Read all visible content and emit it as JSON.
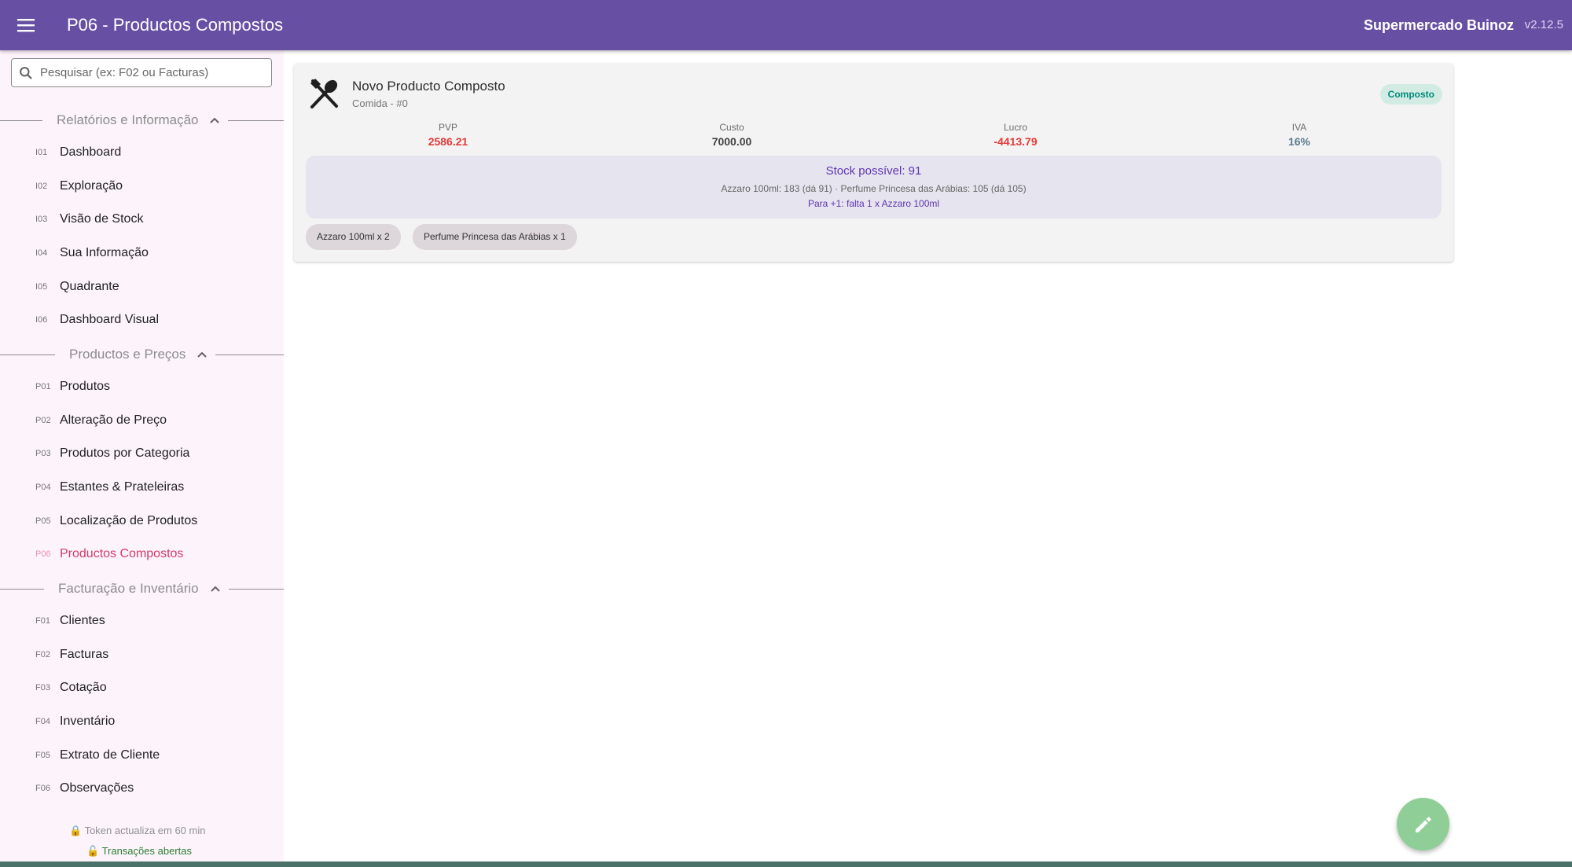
{
  "header": {
    "title": "P06 - Productos Compostos",
    "brand": "Supermercado Buinoz",
    "version": "v2.12.5"
  },
  "search": {
    "placeholder": "Pesquisar (ex: F02 ou Facturas)"
  },
  "sidebar": {
    "sections": [
      {
        "label": "Relatórios e Informação",
        "items": [
          {
            "code": "I01",
            "label": "Dashboard"
          },
          {
            "code": "I02",
            "label": "Exploração"
          },
          {
            "code": "I03",
            "label": "Visão de Stock"
          },
          {
            "code": "I04",
            "label": "Sua Informação"
          },
          {
            "code": "I05",
            "label": "Quadrante"
          },
          {
            "code": "I06",
            "label": "Dashboard Visual"
          }
        ]
      },
      {
        "label": "Productos e Preços",
        "items": [
          {
            "code": "P01",
            "label": "Produtos"
          },
          {
            "code": "P02",
            "label": "Alteração de Preço"
          },
          {
            "code": "P03",
            "label": "Produtos por Categoria"
          },
          {
            "code": "P04",
            "label": "Estantes & Prateleiras"
          },
          {
            "code": "P05",
            "label": "Localização de Produtos"
          },
          {
            "code": "P06",
            "label": "Productos Compostos",
            "active": true
          }
        ]
      },
      {
        "label": "Facturação e Inventário",
        "items": [
          {
            "code": "F01",
            "label": "Clientes"
          },
          {
            "code": "F02",
            "label": "Facturas"
          },
          {
            "code": "F03",
            "label": "Cotação"
          },
          {
            "code": "F04",
            "label": "Inventário"
          },
          {
            "code": "F05",
            "label": "Extrato de Cliente"
          },
          {
            "code": "F06",
            "label": "Observações"
          }
        ]
      }
    ],
    "footer": {
      "token": "🔒 Token actualiza em 60 min",
      "transactions": "🔓 Transações abertas"
    }
  },
  "product": {
    "icon": "cutlery-icon",
    "name": "Novo Producto Composto",
    "subtitle": "Comida - #0",
    "badge": "Composto",
    "stats": [
      {
        "label": "PVP",
        "value": "2586.21",
        "color": "#e53935"
      },
      {
        "label": "Custo",
        "value": "7000.00",
        "color": "#424242"
      },
      {
        "label": "Lucro",
        "value": "-4413.79",
        "color": "#e53935"
      },
      {
        "label": "IVA",
        "value": "16%",
        "color": "#5d7c8f"
      }
    ],
    "stock_title": "Stock possível: 91",
    "stock_detail": "Azzaro 100ml: 183 (dá 91)  ·  Perfume Princesa das Arábias: 105 (dá 105)",
    "stock_need": "Para +1: falta 1 x Azzaro 100ml",
    "components": [
      "Azzaro 100ml x 2",
      "Perfume Princesa das Arábias x 1"
    ]
  },
  "fab": {
    "icon": "pencil-icon"
  },
  "colors": {
    "topbar": "#6750a4",
    "active": "#d33b6a",
    "sidebar": "#fdf4fb",
    "fab": "#8fcf97"
  }
}
